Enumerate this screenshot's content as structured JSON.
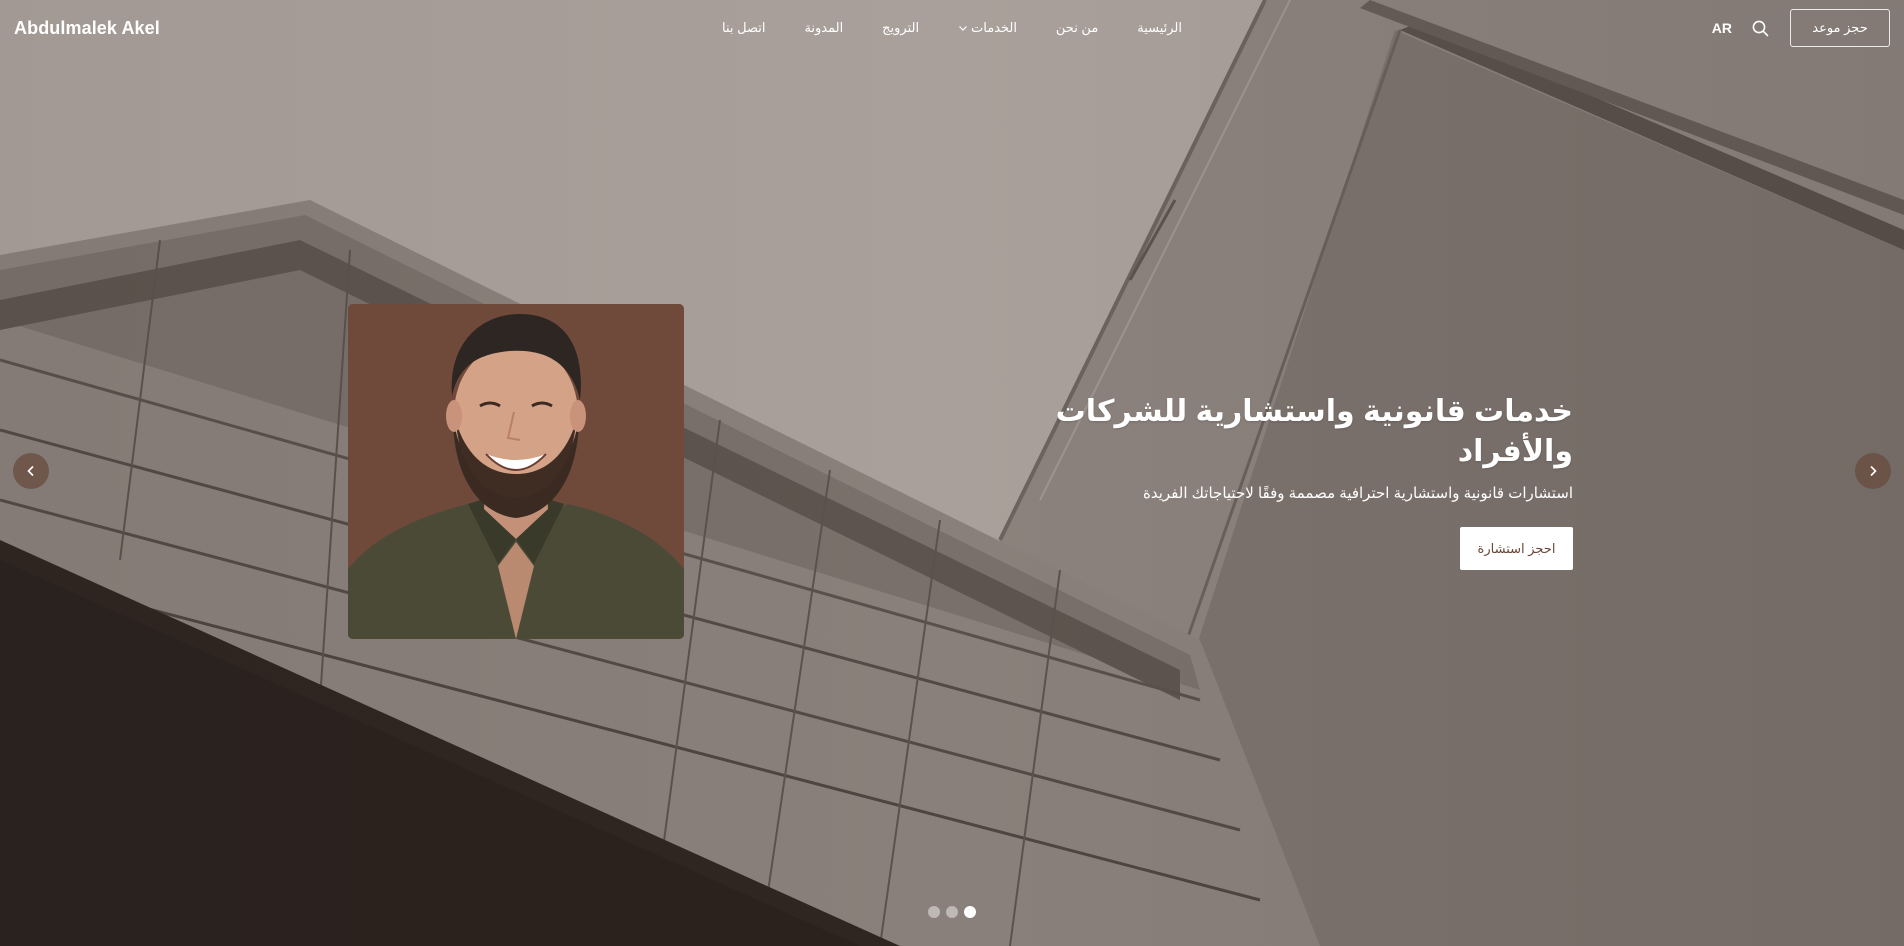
{
  "header": {
    "logo": "Abdulmalek Akel",
    "nav": [
      {
        "label": "الرئيسية",
        "has_dropdown": false
      },
      {
        "label": "من نحن",
        "has_dropdown": false
      },
      {
        "label": "الخدمات",
        "has_dropdown": true
      },
      {
        "label": "الترويج",
        "has_dropdown": false
      },
      {
        "label": "المدونة",
        "has_dropdown": false
      },
      {
        "label": "اتصل بنا",
        "has_dropdown": false
      }
    ],
    "language": "AR",
    "search_icon": "search-icon",
    "book_button": "حجز موعد"
  },
  "hero": {
    "title": "خدمات قانونية واستشارية للشركات والأفراد",
    "subtitle": "استشارات قانونية واستشارية احترافية مصممة وفقًا لاحتياجاتك الفريدة",
    "cta": "احجز استشارة"
  },
  "carousel": {
    "prev_icon": "chevron-left-icon",
    "next_icon": "chevron-right-icon",
    "slide_count": 3,
    "active_slide": 3
  },
  "colors": {
    "accent": "#6b4636",
    "portrait_bg": "#6f4a3a",
    "arrow_bg": "#684b3e"
  }
}
